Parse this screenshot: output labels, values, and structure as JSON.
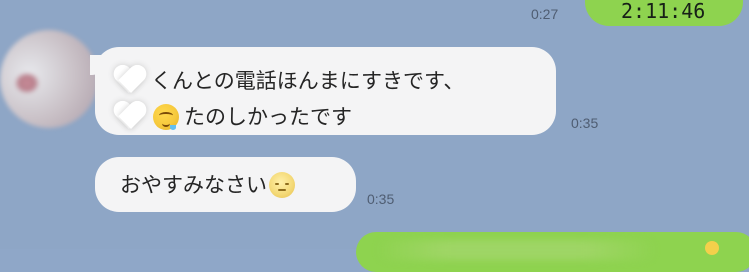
{
  "messages": {
    "outgoing_top": {
      "text": "2:11:46",
      "time": "0:27"
    },
    "incoming_1": {
      "line1": "くんとの電話ほんまにすきです、",
      "line2": "たのしかったです",
      "time": "0:35",
      "icons": [
        "heart-icon",
        "drooling-face-icon"
      ]
    },
    "incoming_2": {
      "text": "おやすみなさい",
      "time": "0:35",
      "icons": [
        "moon-face-icon"
      ]
    }
  }
}
